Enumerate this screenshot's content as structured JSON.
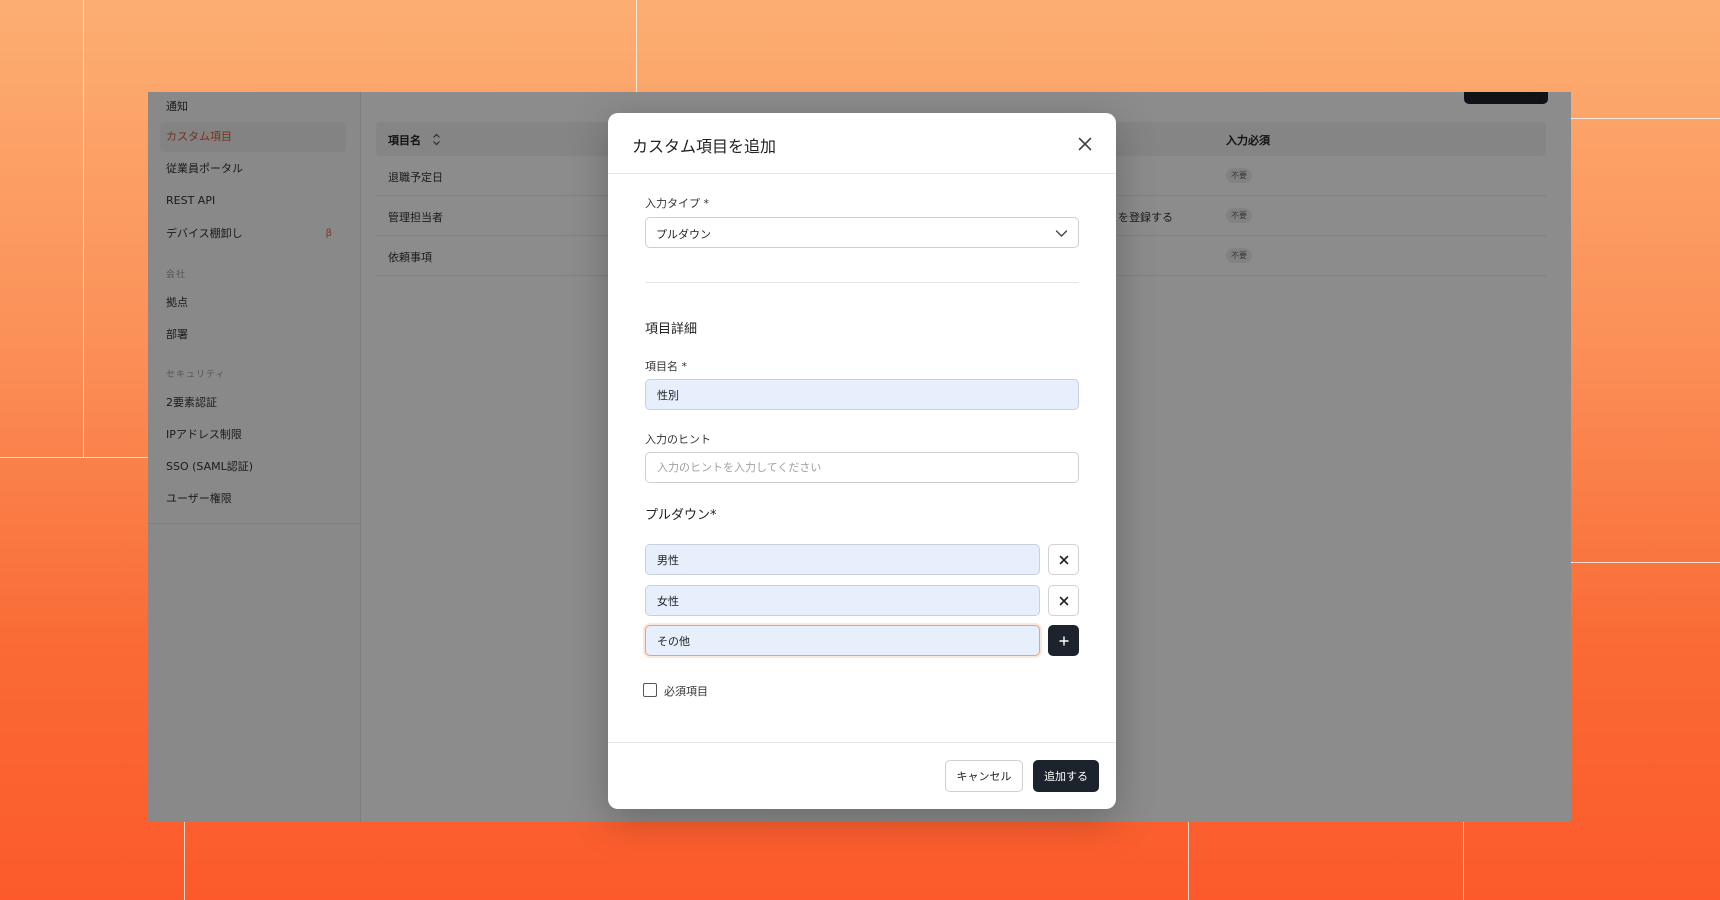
{
  "sidebar": {
    "items": [
      {
        "label": "通知"
      },
      {
        "label": "カスタム項目"
      },
      {
        "label": "従業員ポータル"
      },
      {
        "label": "REST API"
      },
      {
        "label": "デバイス棚卸し",
        "badge": "β"
      },
      {
        "label": "拠点"
      },
      {
        "label": "部署"
      },
      {
        "label": "2要素認証"
      },
      {
        "label": "IPアドレス制限"
      },
      {
        "label": "SSO (SAML認証)"
      },
      {
        "label": "ユーザー権限"
      }
    ],
    "sections": {
      "company": "会社",
      "security": "セキュリティ"
    }
  },
  "table": {
    "columns": {
      "name": "項目名",
      "required": "入力必須"
    },
    "rows": [
      {
        "name": "退職予定日",
        "hint": "",
        "required": "不要"
      },
      {
        "name": "管理担当者",
        "hint": "を登録する",
        "required": "不要"
      },
      {
        "name": "依頼事項",
        "hint": "",
        "required": "不要"
      }
    ]
  },
  "modal": {
    "title": "カスタム項目を追加",
    "input_type_label": "入力タイプ *",
    "input_type_value": "プルダウン",
    "details_title": "項目詳細",
    "item_name_label": "項目名 *",
    "item_name_value": "性別",
    "hint_label": "入力のヒント",
    "hint_placeholder": "入力のヒントを入力してください",
    "pulldown_label": "プルダウン*",
    "options": [
      "男性",
      "女性",
      "その他"
    ],
    "required_checkbox_label": "必須項目",
    "required_checked": false,
    "cancel_label": "キャンセル",
    "add_label": "追加する"
  },
  "colors": {
    "accent": "#e0572a",
    "dark_button": "#1d232c",
    "filled_input": "#e7eefc",
    "focus_border": "#e6a376"
  },
  "icons": {
    "close": "close-icon",
    "chevron": "chevron-down-icon",
    "sort": "sort-icon",
    "remove": "x-icon",
    "add": "plus-icon"
  }
}
